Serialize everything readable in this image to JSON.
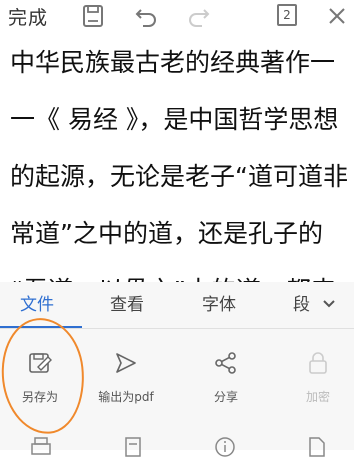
{
  "toolbar": {
    "done_label": "完成",
    "tab_count": "2",
    "icons": [
      "save-icon",
      "undo-icon",
      "redo-icon",
      "tabs-icon",
      "close-icon"
    ]
  },
  "document": {
    "lines": [
      "中华民族最古老的经典著作一",
      "一《 易经 》，是中国哲学思想",
      "的起源，无论是老子“道可道非",
      "常道”之中的道，还是孔子的",
      "“吾道一以贯之”中的道，都来"
    ]
  },
  "menu_tabs": [
    {
      "label": "文件",
      "active": true
    },
    {
      "label": "查看",
      "active": false
    },
    {
      "label": "字体",
      "active": false
    },
    {
      "label": "段",
      "active": false
    }
  ],
  "tools": [
    {
      "label": "另存为",
      "icon": "save-as-icon",
      "enabled": true
    },
    {
      "label": "输出为pdf",
      "icon": "export-pdf-icon",
      "enabled": true
    },
    {
      "label": "分享",
      "icon": "share-icon",
      "enabled": true
    },
    {
      "label": "加密",
      "icon": "lock-icon",
      "enabled": false
    }
  ],
  "colors": {
    "accent": "#2f6fd1",
    "annotation": "#f0892c"
  }
}
